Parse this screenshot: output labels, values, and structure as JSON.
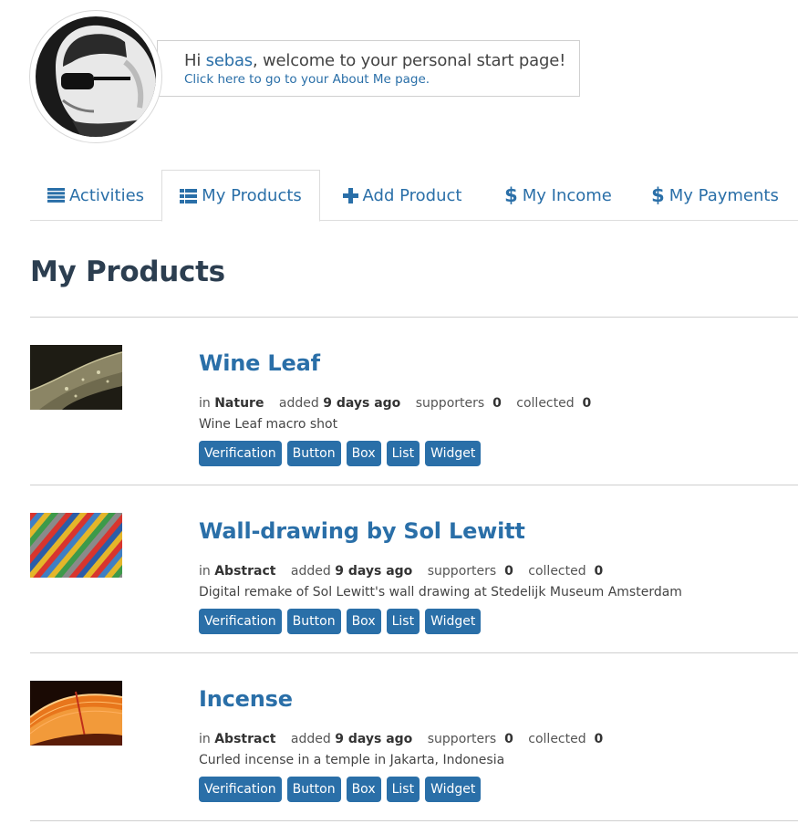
{
  "header": {
    "greeting_prefix": "Hi",
    "username": "sebas",
    "greeting_suffix": ", welcome to your personal start page!",
    "about_link": "Click here to go to your About Me page."
  },
  "tabs": [
    {
      "label": "Activities",
      "icon": "list-icon"
    },
    {
      "label": "My Products",
      "icon": "th-list-icon",
      "active": true
    },
    {
      "label": "Add Product",
      "icon": "plus-icon"
    },
    {
      "label": "My Income",
      "icon": "dollar-icon"
    },
    {
      "label": "My Payments",
      "icon": "dollar-icon"
    }
  ],
  "main": {
    "title": "My Products",
    "meta_labels": {
      "in": "in",
      "added": "added",
      "supporters": "supporters",
      "collected": "collected"
    },
    "buttons": [
      "Verification",
      "Button",
      "Box",
      "List",
      "Widget"
    ],
    "products": [
      {
        "title": "Wine Leaf",
        "category": "Nature",
        "added": "9 days ago",
        "supporters": "0",
        "collected": "0",
        "description": "Wine Leaf macro shot"
      },
      {
        "title": "Wall-drawing by Sol Lewitt",
        "category": "Abstract",
        "added": "9 days ago",
        "supporters": "0",
        "collected": "0",
        "description": "Digital remake of Sol Lewitt's wall drawing at Stedelijk Museum Amsterdam"
      },
      {
        "title": "Incense",
        "category": "Abstract",
        "added": "9 days ago",
        "supporters": "0",
        "collected": "0",
        "description": "Curled incense in a temple in Jakarta, Indonesia"
      }
    ]
  },
  "colors": {
    "link": "#2a6fa8",
    "title": "#2c3e50",
    "button": "#2a6fa8"
  }
}
